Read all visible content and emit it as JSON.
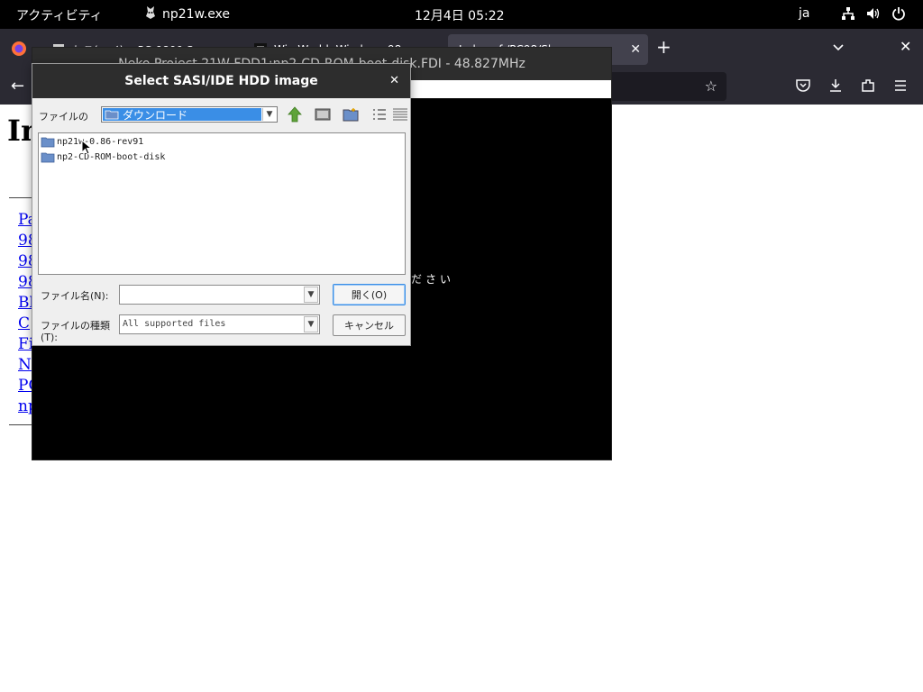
{
  "topbar": {
    "activities": "アクティビティ",
    "app_name": "np21w.exe",
    "clock": "12月4日  05:22",
    "ime": "ja",
    "tray_icons": [
      "network-icon",
      "volume-icon",
      "power-icon"
    ]
  },
  "browser": {
    "tabs": [
      {
        "label": "ねこ(ィイ)... PC-9800 Se..."
      },
      {
        "label": "Win World: Windows 98 ..."
      },
      {
        "label": "Index of /PC98/Sh..."
      }
    ]
  },
  "page": {
    "heading": "In",
    "links": [
      "Pa",
      "98",
      "98",
      "98",
      "Bl",
      "C",
      "Fi",
      "N",
      "PC",
      "np"
    ]
  },
  "neko_window": {
    "title": "Neko Project 21W  FDD1:np2-CD-ROM-boot-disk.FDI - 48.827MHz",
    "screen_text": "ださい"
  },
  "dialog": {
    "title": "Select SASI/IDE HDD image",
    "look_in_label": "ファイルの",
    "look_in_value": "ダウンロード",
    "files": [
      "np21w-0.86-rev91",
      "np2-CD-ROM-boot-disk"
    ],
    "filename_label": "ファイル名(N):",
    "filename_value": "",
    "filetype_label_1": "ファイルの種類",
    "filetype_label_2": "(T):",
    "filetype_value": "All supported files",
    "open_button": "開く(O)",
    "cancel_button": "キャンセル"
  }
}
